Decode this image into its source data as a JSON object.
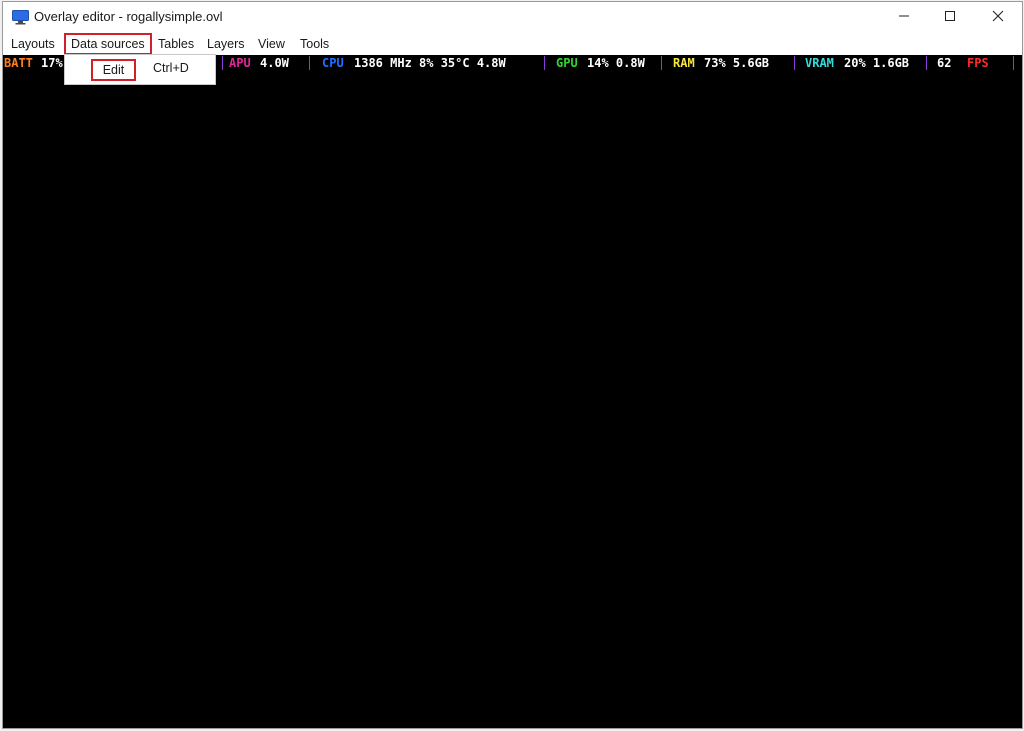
{
  "window": {
    "title": "Overlay editor - rogallysimple.ovl",
    "icon": "monitor-icon",
    "controls": [
      "minimize-icon",
      "maximize-icon",
      "close-icon"
    ]
  },
  "menubar": {
    "items": [
      {
        "label": "Layouts"
      },
      {
        "label": "Data sources",
        "highlighted": true
      },
      {
        "label": "Tables"
      },
      {
        "label": "Layers"
      },
      {
        "label": "View"
      },
      {
        "label": "Tools"
      }
    ]
  },
  "dropdown": {
    "items": [
      {
        "label": "Edit",
        "shortcut": "Ctrl+D",
        "highlighted": true
      }
    ]
  },
  "overlay": {
    "colors": {
      "batt": "#ff7f1f",
      "apu": "#e0269a",
      "cpu": "#1f6fff",
      "gpu": "#33d133",
      "ram": "#f5e642",
      "vram": "#36dcdc",
      "fps": "#ff2a2a",
      "value": "#ffffff",
      "separator": "#8a3cd6"
    },
    "segments": {
      "batt_label": "BATT",
      "batt_value": "17%",
      "apu_label": "APU",
      "apu_value": "4.0W",
      "cpu_label": "CPU",
      "cpu_value": "1386 MHz 8%  35°C 4.8W",
      "gpu_label": "GPU",
      "gpu_value": "14% 0.8W",
      "ram_label": "RAM",
      "ram_value": "73% 5.6GB",
      "vram_label": "VRAM",
      "vram_value": "20% 1.6GB",
      "fps_value": "62",
      "fps_label": "FPS"
    }
  }
}
